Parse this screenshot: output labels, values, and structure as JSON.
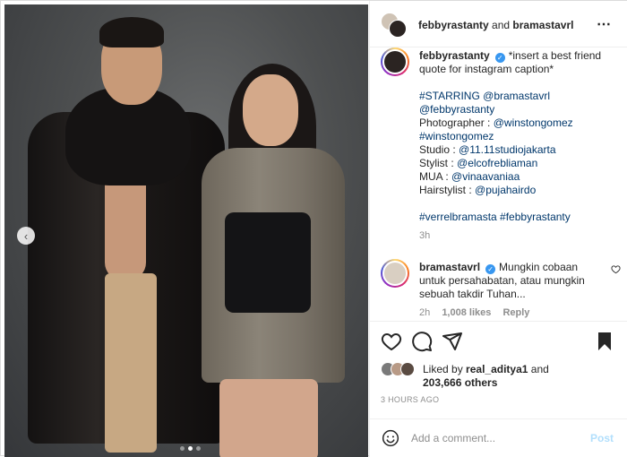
{
  "header": {
    "user1": "febbyrastanty",
    "and": "and",
    "user2": "bramastavrl",
    "more_icon": "more-horizontal-icon"
  },
  "caption": {
    "username": "febbyrastanty",
    "text_line1": "*insert a best friend",
    "text_line2": "quote for instagram caption*",
    "starring_tag": "#STARRING",
    "starring_mention": "@bramastavrl",
    "mention_febby": "@febbyrastanty",
    "photographer_label": "Photographer :",
    "photographer_handle": "@winstongomez",
    "photographer_tag": "#winstongomez",
    "studio_label": "Studio :",
    "studio_handle": "@11.11studiojakarta",
    "stylist_label": "Stylist :",
    "stylist_handle": "@elcofrebliaman",
    "mua_label": "MUA :",
    "mua_handle": "@vinaavaniaa",
    "hair_label": "Hairstylist :",
    "hair_handle": "@pujahairdo",
    "hashtag1": "#verrelbramasta",
    "hashtag2": "#febbyrastanty",
    "time": "3h"
  },
  "comment": {
    "username": "bramastavrl",
    "text_line1": "Mungkin cobaan",
    "text_line2": "untuk persahabatan, atau mungkin",
    "text_line3": "sebuah takdir Tuhan...",
    "time": "2h",
    "likes": "1,008 likes",
    "reply": "Reply"
  },
  "likes": {
    "liked_by": "Liked by",
    "user": "real_aditya1",
    "and": "and",
    "others": "203,666 others"
  },
  "timestamp": "3 HOURS AGO",
  "add_comment": {
    "placeholder": "Add a comment...",
    "post_label": "Post"
  },
  "carousel": {
    "slides": 3,
    "active": 2,
    "prev_icon": "chevron-left-icon"
  },
  "colors": {
    "link": "#00376b",
    "verified": "#3897f0",
    "muted": "#8e8e8e",
    "post_disabled": "#b2dffc"
  }
}
